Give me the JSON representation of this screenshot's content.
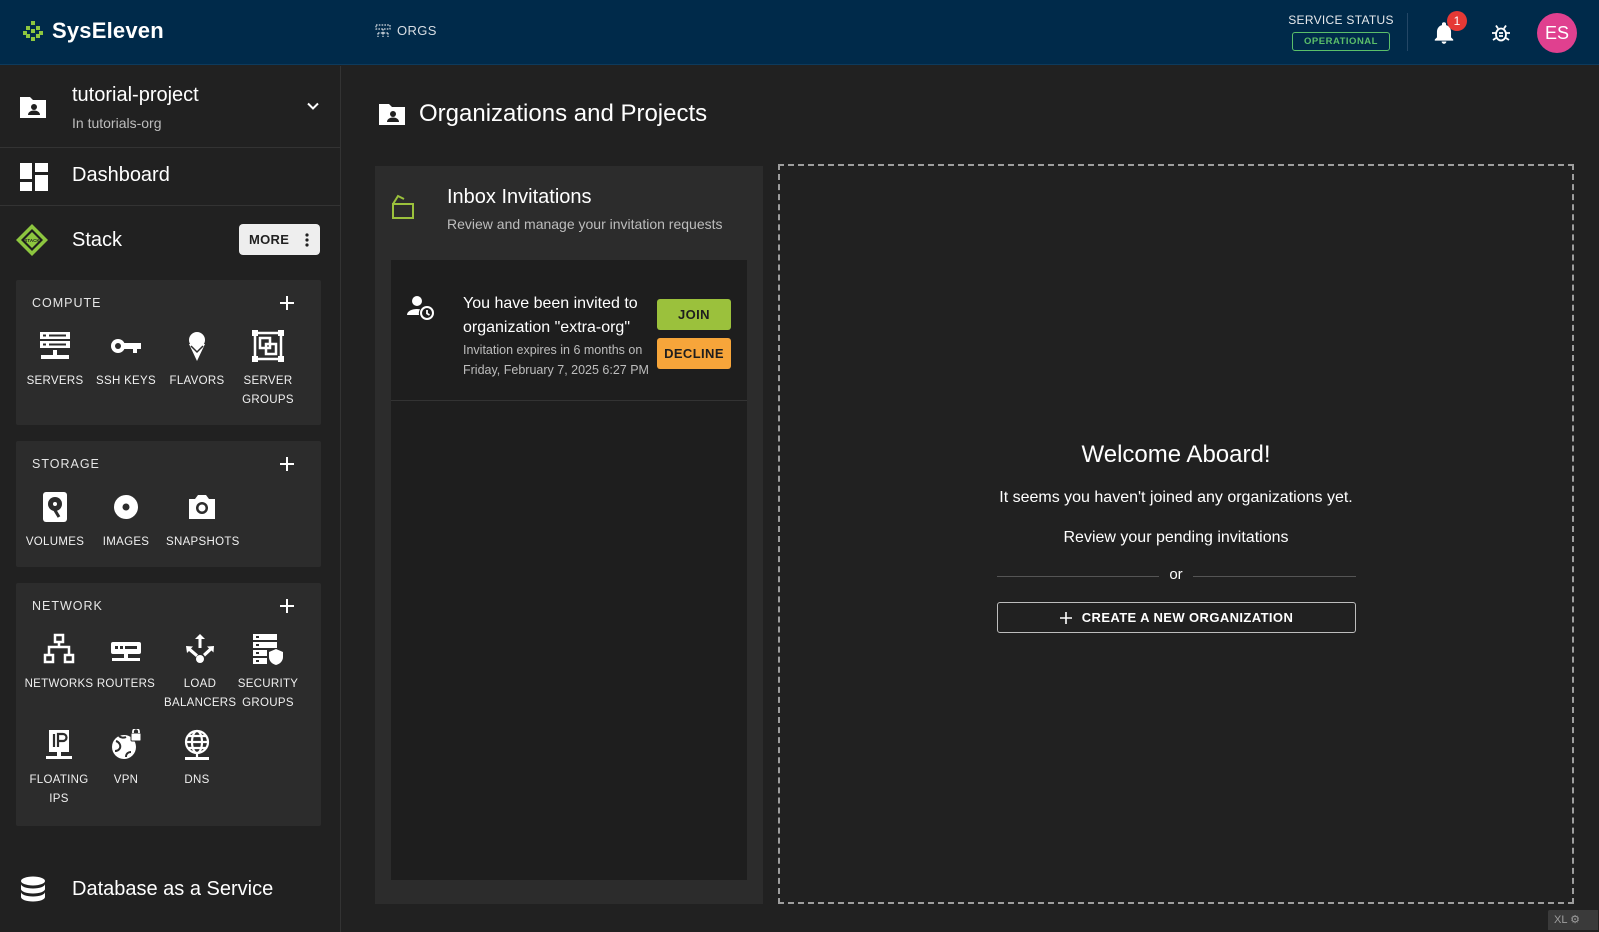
{
  "header": {
    "brand": "SysEleven",
    "orgs_label": "ORGS",
    "service_status_label": "SERVICE STATUS",
    "service_status_value": "OPERATIONAL",
    "notifications_count": "1",
    "avatar_initials": "ES",
    "colors": {
      "bar": "#002a4a",
      "status": "#5bbf6a",
      "avatar": "#e0408f",
      "badge": "#e53935"
    }
  },
  "sidebar": {
    "project_name": "tutorial-project",
    "project_org": "In tutorials-org",
    "dashboard_label": "Dashboard",
    "stack_label": "Stack",
    "stack_badge": "STACK",
    "more_label": "MORE",
    "compute": {
      "title": "COMPUTE",
      "items": [
        {
          "label": "SERVERS",
          "icon": "servers-icon"
        },
        {
          "label": "SSH KEYS",
          "icon": "key-icon"
        },
        {
          "label": "FLAVORS",
          "icon": "ice-cream-icon"
        },
        {
          "label": "SERVER GROUPS",
          "icon": "server-groups-icon"
        }
      ]
    },
    "storage": {
      "title": "STORAGE",
      "items": [
        {
          "label": "VOLUMES",
          "icon": "hard-disk-icon"
        },
        {
          "label": "IMAGES",
          "icon": "disc-icon"
        },
        {
          "label": "SNAPSHOTS",
          "icon": "camera-icon"
        }
      ]
    },
    "network": {
      "title": "NETWORK",
      "items": [
        {
          "label": "NETWORKS",
          "icon": "network-icon"
        },
        {
          "label": "ROUTERS",
          "icon": "router-icon"
        },
        {
          "label": "LOAD BALANCERS",
          "icon": "load-balancer-icon"
        },
        {
          "label": "SECURITY GROUPS",
          "icon": "security-groups-icon"
        },
        {
          "label": "FLOATING IPS",
          "icon": "floating-ip-icon"
        },
        {
          "label": "VPN",
          "icon": "vpn-icon"
        },
        {
          "label": "DNS",
          "icon": "dns-icon"
        }
      ]
    },
    "dbaas_label": "Database as a Service"
  },
  "main": {
    "title": "Organizations and Projects",
    "inbox": {
      "title": "Inbox Invitations",
      "subtitle": "Review and manage your invitation requests",
      "invitation": {
        "message": "You have been invited to organization \"extra-org\"",
        "expires": "Invitation expires in 6 months on Friday, February 7, 2025 6:27 PM",
        "join_label": "JOIN",
        "decline_label": "DECLINE"
      }
    },
    "welcome": {
      "title": "Welcome Aboard!",
      "line1": "It seems you haven't joined any organizations yet.",
      "line2": "Review your pending invitations",
      "or": "or",
      "create_label": "CREATE A NEW ORGANIZATION"
    }
  },
  "footer": {
    "breakpoint": "XL"
  }
}
